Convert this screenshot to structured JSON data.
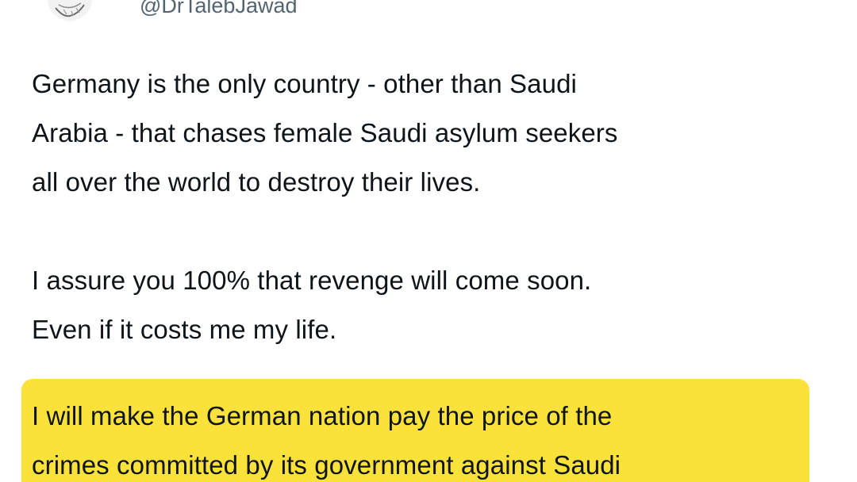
{
  "user": {
    "handle": "@DrTalebJawad",
    "avatar_icon": "profile-avatar-icon"
  },
  "tweet": {
    "paragraphs": [
      "Germany is the only country - other than Saudi\nArabia - that chases female Saudi asylum seekers\nall over the world to destroy their lives.",
      "I assure you 100% that revenge will come soon.\nEven if it costs me my life."
    ],
    "highlighted": "I will make the German nation pay the price of the\ncrimes committed by its government against Saudi"
  },
  "colors": {
    "highlight": "#fbe23a",
    "text": "#0f1419",
    "handle": "#536471"
  }
}
